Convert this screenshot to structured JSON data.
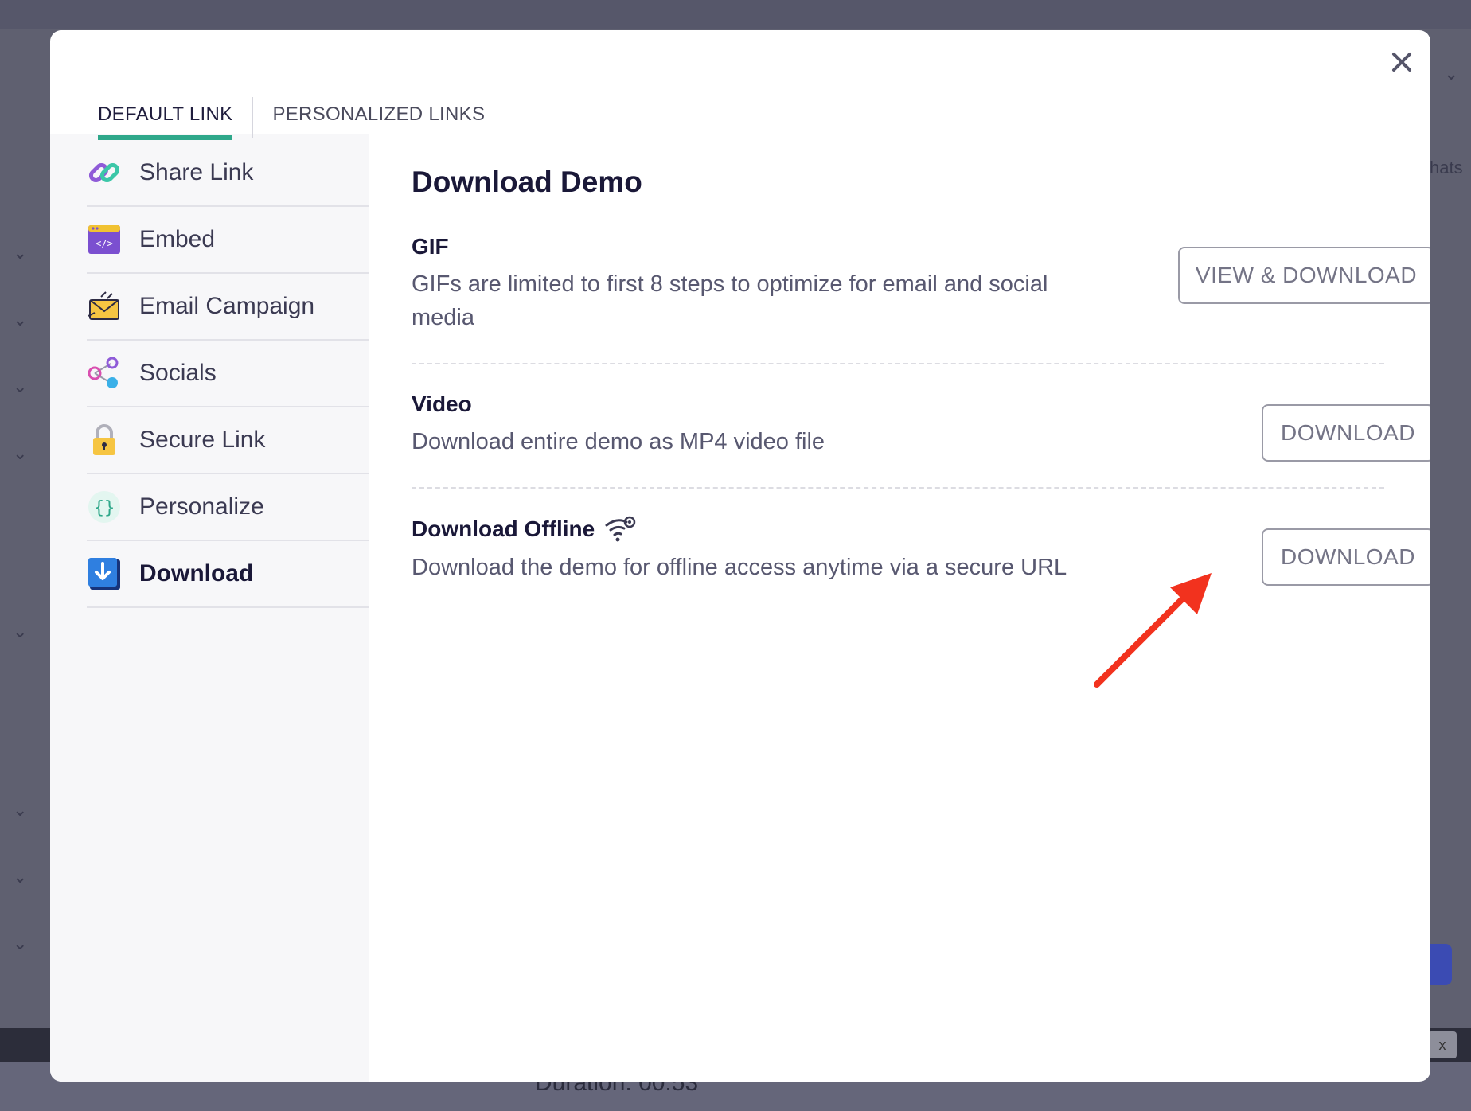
{
  "modal": {
    "tabs": [
      {
        "label": "DEFAULT LINK",
        "active": true
      },
      {
        "label": "PERSONALIZED LINKS",
        "active": false
      }
    ],
    "sidebar": {
      "items": [
        {
          "label": "Share Link",
          "icon": "link-icon"
        },
        {
          "label": "Embed",
          "icon": "embed-code-icon"
        },
        {
          "label": "Email Campaign",
          "icon": "envelope-icon"
        },
        {
          "label": "Socials",
          "icon": "share-nodes-icon"
        },
        {
          "label": "Secure Link",
          "icon": "padlock-icon"
        },
        {
          "label": "Personalize",
          "icon": "curly-braces-icon"
        },
        {
          "label": "Download",
          "icon": "download-arrow-icon",
          "active": true
        }
      ]
    },
    "content": {
      "title": "Download Demo",
      "sections": [
        {
          "title": "GIF",
          "description": "GIFs are limited to first 8 steps to optimize for email and social media",
          "button": "VIEW & DOWNLOAD"
        },
        {
          "title": "Video",
          "description": "Download entire demo as MP4 video file",
          "button": "DOWNLOAD"
        },
        {
          "title": "Download Offline",
          "icon": "wifi-off-icon",
          "description": "Download the demo for offline access anytime via a secure URL",
          "button": "DOWNLOAD"
        }
      ]
    }
  },
  "backdrop": {
    "right_text": "hats",
    "duration_text": "Duration: 00:53",
    "x_label": "x"
  },
  "colors": {
    "accent": "#2fa88a",
    "annotation_arrow": "#f2321e",
    "overlay": "#5f6070"
  }
}
